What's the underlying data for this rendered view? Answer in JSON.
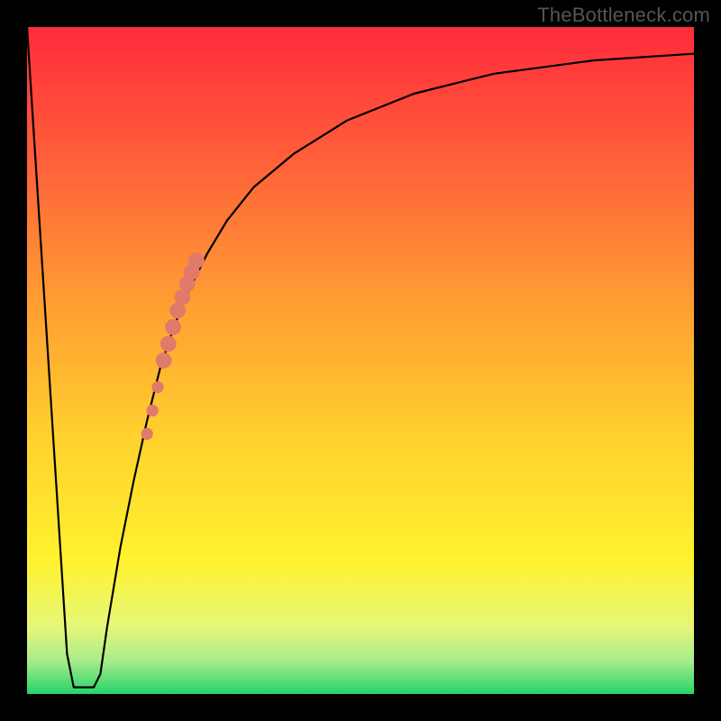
{
  "credit_text": "TheBottleneck.com",
  "chart_data": {
    "type": "line",
    "title": "",
    "xlabel": "",
    "ylabel": "",
    "xlim": [
      0,
      100
    ],
    "ylim": [
      0,
      100
    ],
    "grid": false,
    "background": "heatmap-gradient-red-to-green-vertical",
    "series": [
      {
        "name": "bottleneck-curve",
        "color": "#000000",
        "x": [
          0,
          6,
          7,
          8,
          9,
          10,
          11,
          12,
          14,
          16,
          18,
          20,
          22,
          24,
          27,
          30,
          34,
          40,
          48,
          58,
          70,
          85,
          100
        ],
        "values": [
          100,
          6,
          1,
          1,
          1,
          1,
          3,
          10,
          22,
          32,
          41,
          49,
          55,
          60,
          66,
          71,
          76,
          81,
          86,
          90,
          93,
          95,
          96
        ]
      }
    ],
    "markers": {
      "name": "highlighted-points",
      "color": "#e07a6a",
      "points": [
        {
          "x": 18.0,
          "y": 39.0,
          "r": 0.9
        },
        {
          "x": 18.8,
          "y": 42.5,
          "r": 0.9
        },
        {
          "x": 19.6,
          "y": 46.0,
          "r": 0.9
        },
        {
          "x": 20.5,
          "y": 50.0,
          "r": 1.2
        },
        {
          "x": 21.2,
          "y": 52.5,
          "r": 1.2
        },
        {
          "x": 21.9,
          "y": 55.0,
          "r": 1.2
        },
        {
          "x": 22.6,
          "y": 57.5,
          "r": 1.2
        },
        {
          "x": 23.3,
          "y": 59.5,
          "r": 1.2
        },
        {
          "x": 24.0,
          "y": 61.5,
          "r": 1.2
        },
        {
          "x": 24.7,
          "y": 63.3,
          "r": 1.2
        },
        {
          "x": 25.4,
          "y": 65.0,
          "r": 1.2
        }
      ]
    }
  }
}
